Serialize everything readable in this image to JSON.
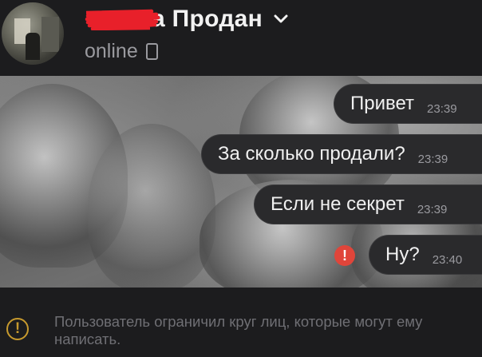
{
  "header": {
    "contact_name_visible": "а Продан",
    "status": "online",
    "icons": {
      "dropdown": "chevron-down-icon",
      "device": "mobile-device-icon",
      "avatar": "avatar"
    }
  },
  "messages": [
    {
      "text": "Привет",
      "time": "23:39",
      "failed": false
    },
    {
      "text": "За сколько продали?",
      "time": "23:39",
      "failed": false
    },
    {
      "text": "Если не секрет",
      "time": "23:39",
      "failed": false
    },
    {
      "text": "Ну?",
      "time": "23:40",
      "failed": true
    }
  ],
  "notice": {
    "text": "Пользователь ограничил круг лиц, которые могут ему написать.",
    "icon": "warning-circle-icon"
  },
  "error_icon_glyph": "!",
  "warn_icon_glyph": "!",
  "colors": {
    "background": "#1c1c1e",
    "bubble": "#2a2a2c",
    "error": "#e0453a",
    "warning": "#c79a2e",
    "redaction": "#e8202a"
  }
}
